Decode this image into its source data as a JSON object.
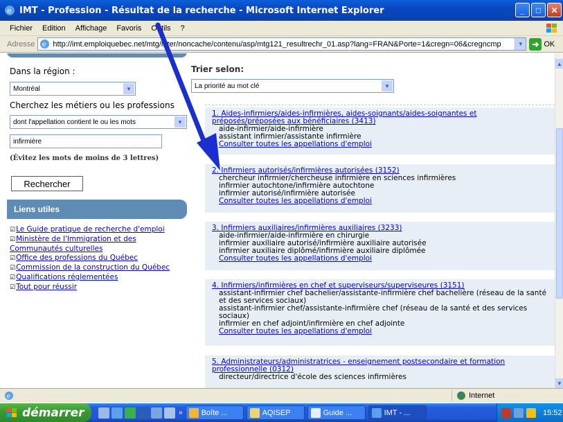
{
  "window": {
    "title": "IMT - Profession - Résultat de la recherche - Microsoft Internet Explorer",
    "controls": {
      "minimize": "_",
      "maximize": "□",
      "close": "✕"
    }
  },
  "menu": [
    "Fichier",
    "Edition",
    "Affichage",
    "Favoris",
    "Outils",
    "?"
  ],
  "address": {
    "label": "Adresse",
    "url": "http://imt.emploiquebec.net/mtg/inter/noncache/contenu/asp/mtg121_resultrechr_01.asp?lang=FRAN&Porte=1&cregn=06&cregncmp",
    "go_label": "OK"
  },
  "left": {
    "region_label": "Dans la région :",
    "region_value": "Montréal",
    "search_label": "Cherchez les métiers ou les professions",
    "criteria_value": "dont l'appellation contient le ou les mots",
    "keyword_value": "infirmière",
    "hint": "(Évitez les mots de moins de 3 lettres)",
    "search_button": "Rechercher",
    "links_title": "Liens utiles",
    "links": [
      "Le Guide pratique de recherche d'emploi",
      "Ministère de l'Immigration et des",
      "Communautés culturelles",
      "Office des professions du Québec",
      "Commission de la construction du Québec",
      "Qualifications réglementées",
      "Tout pour réussir"
    ]
  },
  "right": {
    "sort_label": "Trier selon:",
    "sort_value": "La priorité au mot clé",
    "results": [
      {
        "title": "1. Aides-infirmiers/aides-infirmières, aides-soignants/aides-soignantes et préposés/préposées aux bénéficiaires (3413)",
        "appellations": [
          "aide-infirmier/aide-infirmière",
          "assistant infirmier/assistante infirmière"
        ],
        "link": "Consulter toutes les appellations d'emploi"
      },
      {
        "title": "2. Infirmiers autorisés/infirmières autorisées (3152)",
        "appellations": [
          "chercheur infirmier/chercheuse infirmière en sciences infirmières",
          "infirmier autochtone/infirmière autochtone",
          "infirmier autorisé/infirmière autorisée"
        ],
        "link": "Consulter toutes les appellations d'emploi"
      },
      {
        "title": "3. Infirmiers auxiliaires/infirmières auxiliaires (3233)",
        "appellations": [
          "aide-infirmier/aide-infirmière en chirurgie",
          "infirmier auxiliaire autorisé/infirmière auxiliaire autorisée",
          "infirmier auxiliaire diplômé/infirmière auxiliaire diplômée"
        ],
        "link": "Consulter toutes les appellations d'emploi"
      },
      {
        "title": "4. Infirmiers/infirmières en chef et superviseurs/superviseures (3151)",
        "appellations": [
          "assistant-infirmier chef bachelier/assistante-infirmière chef bachelière (réseau de la santé et des services sociaux)",
          "assistant-infirmier chef/assistante-infirmière chef (réseau de la santé et des services sociaux)",
          "infirmier en chef adjoint/infirmière en chef adjointe"
        ],
        "link": "Consulter toutes les appellations d'emploi"
      },
      {
        "title": "5. Administrateurs/administratrices - enseignement postsecondaire et formation professionnelle (0312)",
        "appellations": [
          "directeur/directrice d'école des sciences infirmières"
        ],
        "link": ""
      }
    ]
  },
  "status": {
    "zone": "Internet"
  },
  "taskbar": {
    "start": "démarrer",
    "tasks": [
      "Boîte ...",
      "AQISEP",
      "Guide ...",
      "IMT - ..."
    ],
    "clock": "15:52"
  },
  "colors": {
    "titlebar": "#0a48c0",
    "panel_blue": "#5f8cb5",
    "result_bg": "#e8eef6",
    "link": "#0000cc",
    "arrow": "#1a2fd0"
  }
}
